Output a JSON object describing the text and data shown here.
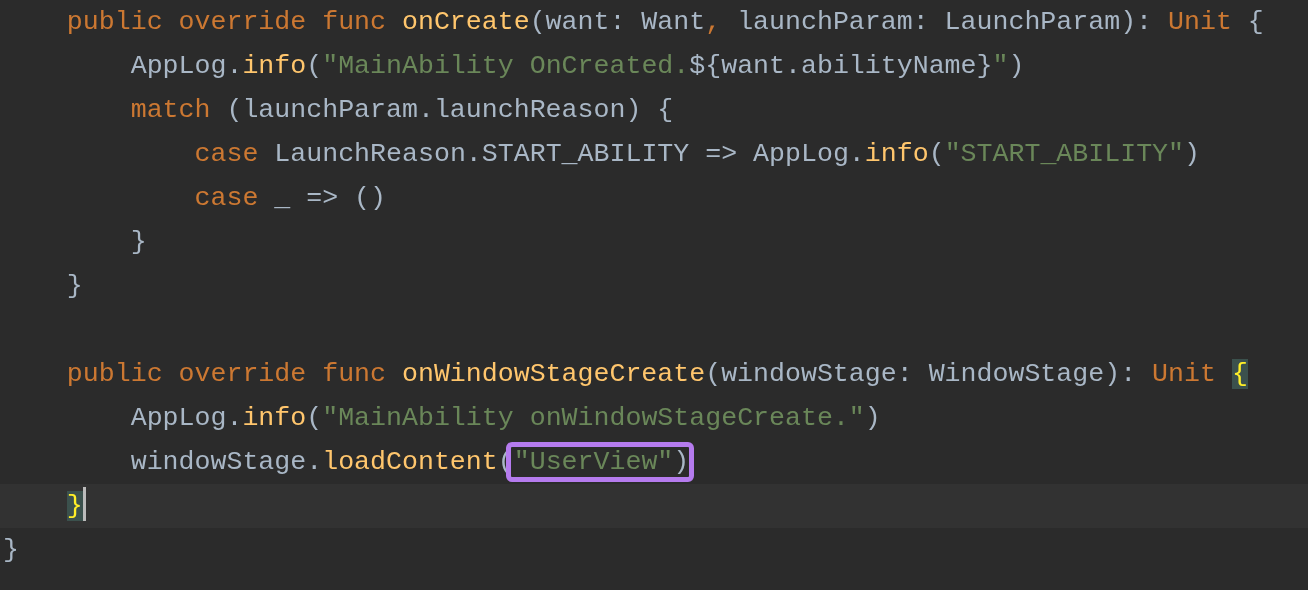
{
  "editor": {
    "lines": [
      {
        "kind": "code",
        "tokens": [
          {
            "kind": "keyword",
            "text": "    public override func "
          },
          {
            "kind": "function",
            "text": "onCreate"
          },
          {
            "kind": "plain",
            "text": "(want: Want"
          },
          {
            "kind": "keyword",
            "text": ", "
          },
          {
            "kind": "plain",
            "text": "launchParam: LaunchParam): "
          },
          {
            "kind": "keyword",
            "text": "Unit"
          },
          {
            "kind": "plain",
            "text": " {"
          }
        ]
      },
      {
        "kind": "code",
        "tokens": [
          {
            "kind": "plain",
            "text": "        AppLog."
          },
          {
            "kind": "function",
            "text": "info"
          },
          {
            "kind": "plain",
            "text": "("
          },
          {
            "kind": "string",
            "text": "\"MainAbility OnCreated."
          },
          {
            "kind": "plain",
            "text": "${want.abilityName}"
          },
          {
            "kind": "string",
            "text": "\""
          },
          {
            "kind": "plain",
            "text": ")"
          }
        ]
      },
      {
        "kind": "code",
        "tokens": [
          {
            "kind": "keyword",
            "text": "        match"
          },
          {
            "kind": "plain",
            "text": " (launchParam.launchReason) {"
          }
        ]
      },
      {
        "kind": "code",
        "tokens": [
          {
            "kind": "keyword",
            "text": "            case"
          },
          {
            "kind": "plain",
            "text": " LaunchReason.START_ABILITY => AppLog."
          },
          {
            "kind": "function",
            "text": "info"
          },
          {
            "kind": "plain",
            "text": "("
          },
          {
            "kind": "string",
            "text": "\"START_ABILITY\""
          },
          {
            "kind": "plain",
            "text": ")"
          }
        ]
      },
      {
        "kind": "code",
        "tokens": [
          {
            "kind": "keyword",
            "text": "            case"
          },
          {
            "kind": "plain",
            "text": " _ => ()"
          }
        ]
      },
      {
        "kind": "code",
        "tokens": [
          {
            "kind": "plain",
            "text": "        }"
          }
        ]
      },
      {
        "kind": "code",
        "tokens": [
          {
            "kind": "plain",
            "text": "    }"
          }
        ]
      },
      {
        "kind": "blank"
      },
      {
        "kind": "code",
        "tokens": [
          {
            "kind": "keyword",
            "text": "    public override func "
          },
          {
            "kind": "function",
            "text": "onWindowStageCreate"
          },
          {
            "kind": "plain",
            "text": "(windowStage: WindowStage): "
          },
          {
            "kind": "keyword",
            "text": "Unit"
          },
          {
            "kind": "matched_brace",
            "text": " {"
          }
        ]
      },
      {
        "kind": "code",
        "tokens": [
          {
            "kind": "plain",
            "text": "        AppLog."
          },
          {
            "kind": "function",
            "text": "info"
          },
          {
            "kind": "plain",
            "text": "("
          },
          {
            "kind": "string",
            "text": "\"MainAbility onWindowStageCreate.\""
          },
          {
            "kind": "plain",
            "text": ")"
          }
        ]
      },
      {
        "kind": "code",
        "tokens": [
          {
            "kind": "plain",
            "text": "        windowStage."
          },
          {
            "kind": "function",
            "text": "loadContent"
          },
          {
            "kind": "plain",
            "text": "("
          },
          {
            "kind": "boxed",
            "children": [
              {
                "kind": "string",
                "text": "\"UserView\""
              },
              {
                "kind": "plain",
                "text": ")"
              }
            ]
          }
        ]
      },
      {
        "kind": "code",
        "tokens": [
          {
            "kind": "matched_brace",
            "text": "    }"
          },
          {
            "kind": "caret"
          }
        ]
      },
      {
        "kind": "code",
        "tokens": [
          {
            "kind": "plain",
            "text": "}"
          }
        ]
      }
    ]
  }
}
